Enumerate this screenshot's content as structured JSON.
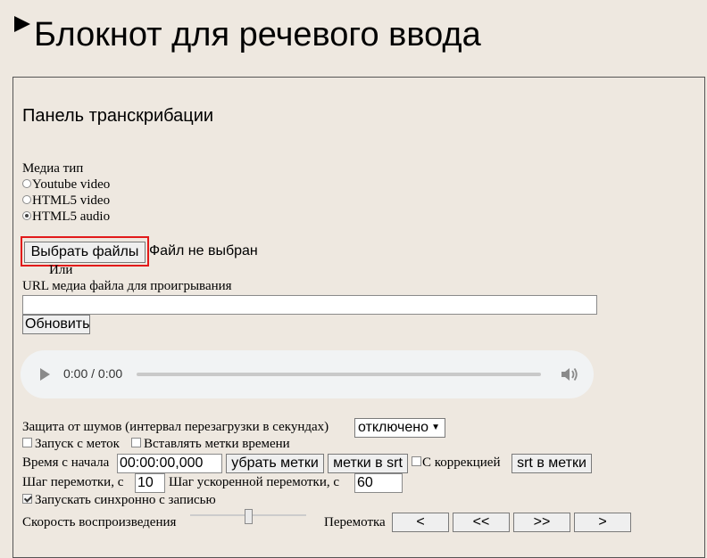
{
  "app": {
    "title": "Блокнот для речевого ввода"
  },
  "panel": {
    "title": "Панель транскрибации",
    "media_type": {
      "label": "Медиа тип",
      "options": [
        {
          "label": "Youtube video",
          "selected": false
        },
        {
          "label": "HTML5 video",
          "selected": false
        },
        {
          "label": "HTML5 audio",
          "selected": true
        }
      ]
    },
    "file": {
      "button_label": "Выбрать файлы",
      "status": "Файл не выбран",
      "or_label": "Или"
    },
    "url": {
      "label": "URL медиа файла для проигрывания",
      "value": "",
      "refresh_label": "Обновить"
    },
    "player": {
      "time": "0:00 / 0:00"
    },
    "noise": {
      "label": "Защита от шумов (интервал перезагрузки в секундах)",
      "selected": "отключено"
    },
    "launch_from_marks": {
      "label": "Запуск с меток",
      "checked": false
    },
    "insert_timestamps": {
      "label": "Вставлять метки времени",
      "checked": false
    },
    "start_time": {
      "label": "Время с начала",
      "value": "00:00:00,000",
      "remove_marks_label": "убрать метки",
      "marks_to_srt_label": "метки в srt",
      "correction_label": "С коррекцией",
      "correction_checked": false,
      "srt_to_marks_label": "srt в метки"
    },
    "step": {
      "label": "Шаг перемотки, с",
      "value": "10",
      "fast_label": "Шаг ускоренной перемотки, с",
      "fast_value": "60"
    },
    "sync_start": {
      "label": "Запускать синхронно с записью",
      "checked": true
    },
    "speed": {
      "label": "Скорость воспроизведения",
      "level": 0.5
    },
    "rewind": {
      "label": "Перемотка",
      "buttons": [
        "<",
        "<<",
        ">>",
        ">"
      ]
    }
  }
}
